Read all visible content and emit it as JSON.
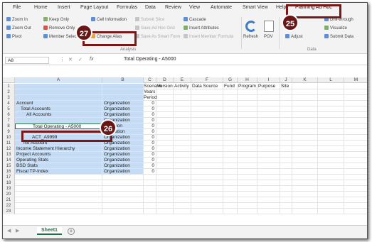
{
  "menu_tabs": [
    "File",
    "Home",
    "Insert",
    "Page Layout",
    "Formulas",
    "Data",
    "Review",
    "View",
    "Automate",
    "Smart View",
    "Help",
    "Planning Ad Hoc"
  ],
  "ribbon": {
    "col1": [
      "Zoom In",
      "Zoom Out",
      "Pivot"
    ],
    "col2": [
      "Keep Only",
      "Remove Only",
      "Member Select"
    ],
    "col3": [
      "Cell Information",
      "Change Alias"
    ],
    "col4": [
      "Submit Slice",
      "Save Ad Hoc Grid",
      "Save As Smart Form"
    ],
    "col5": [
      "Cascade",
      "Insert Attributes",
      "Insert Member Formula"
    ],
    "refresh": "Refresh",
    "pov": "POV",
    "right_items": [
      "Drill-through",
      "Visualize",
      "Submit Data"
    ],
    "adjust": "Adjust",
    "analysis_label": "Analysis",
    "data_label": "Data"
  },
  "formula_bar": {
    "name_box": "A8",
    "content": "Total Operating - A5000"
  },
  "columns": [
    "A",
    "B",
    "C",
    "D",
    "E",
    "F",
    "G",
    "H",
    "I",
    "J",
    "K",
    "L",
    "M"
  ],
  "rows": [
    {
      "n": "1",
      "a": "",
      "b": "",
      "c": "Scenario",
      "d": "Version",
      "e": "Activity",
      "f": "Data Source",
      "g": "Fund",
      "h": "Program",
      "i": "Purpose",
      "j": "Site"
    },
    {
      "n": "2",
      "a": "",
      "b": "",
      "c": "Years"
    },
    {
      "n": "3",
      "a": "",
      "b": "",
      "c": "Period"
    },
    {
      "n": "4",
      "a": "Account",
      "b": "Organization",
      "c": "0"
    },
    {
      "n": "5",
      "a": "Total Accounts",
      "b": "Organization",
      "c": "0"
    },
    {
      "n": "6",
      "a": "All Accounts",
      "b": "Organization",
      "c": "0"
    },
    {
      "n": "7",
      "a": "",
      "b": "Organization",
      "c": "0"
    },
    {
      "n": "8",
      "a": "Total Operating - A5000",
      "b": "anization",
      "c": "0"
    },
    {
      "n": "9",
      "a": "",
      "b": "ganization",
      "c": "0"
    },
    {
      "n": "10",
      "a": "ACT_A9999",
      "b": "Organization",
      "c": "0"
    },
    {
      "n": "11",
      "a": "No Account",
      "b": "Organization",
      "c": "0"
    },
    {
      "n": "12",
      "a": "Income Statement Hierarchy",
      "b": "Organization",
      "c": "0"
    },
    {
      "n": "13",
      "a": "Project Accounts",
      "b": "Organization",
      "c": "0"
    },
    {
      "n": "14",
      "a": "Operating Stats",
      "b": "Organization",
      "c": "0"
    },
    {
      "n": "15",
      "a": "BSD Stats",
      "b": "Organization",
      "c": "0"
    },
    {
      "n": "16",
      "a": "Fiscal TP-Index",
      "b": "Organization",
      "c": "0"
    },
    {
      "n": "17"
    },
    {
      "n": "18"
    },
    {
      "n": "19"
    },
    {
      "n": "20"
    },
    {
      "n": "21"
    },
    {
      "n": "22"
    },
    {
      "n": "23"
    }
  ],
  "sheet_tab": "Sheet1",
  "callouts": {
    "c25": "25",
    "c26": "26",
    "c27": "27"
  },
  "colors": {
    "selection": "#c5dcf4",
    "accent": "#217346",
    "callout": "#6b1616"
  }
}
